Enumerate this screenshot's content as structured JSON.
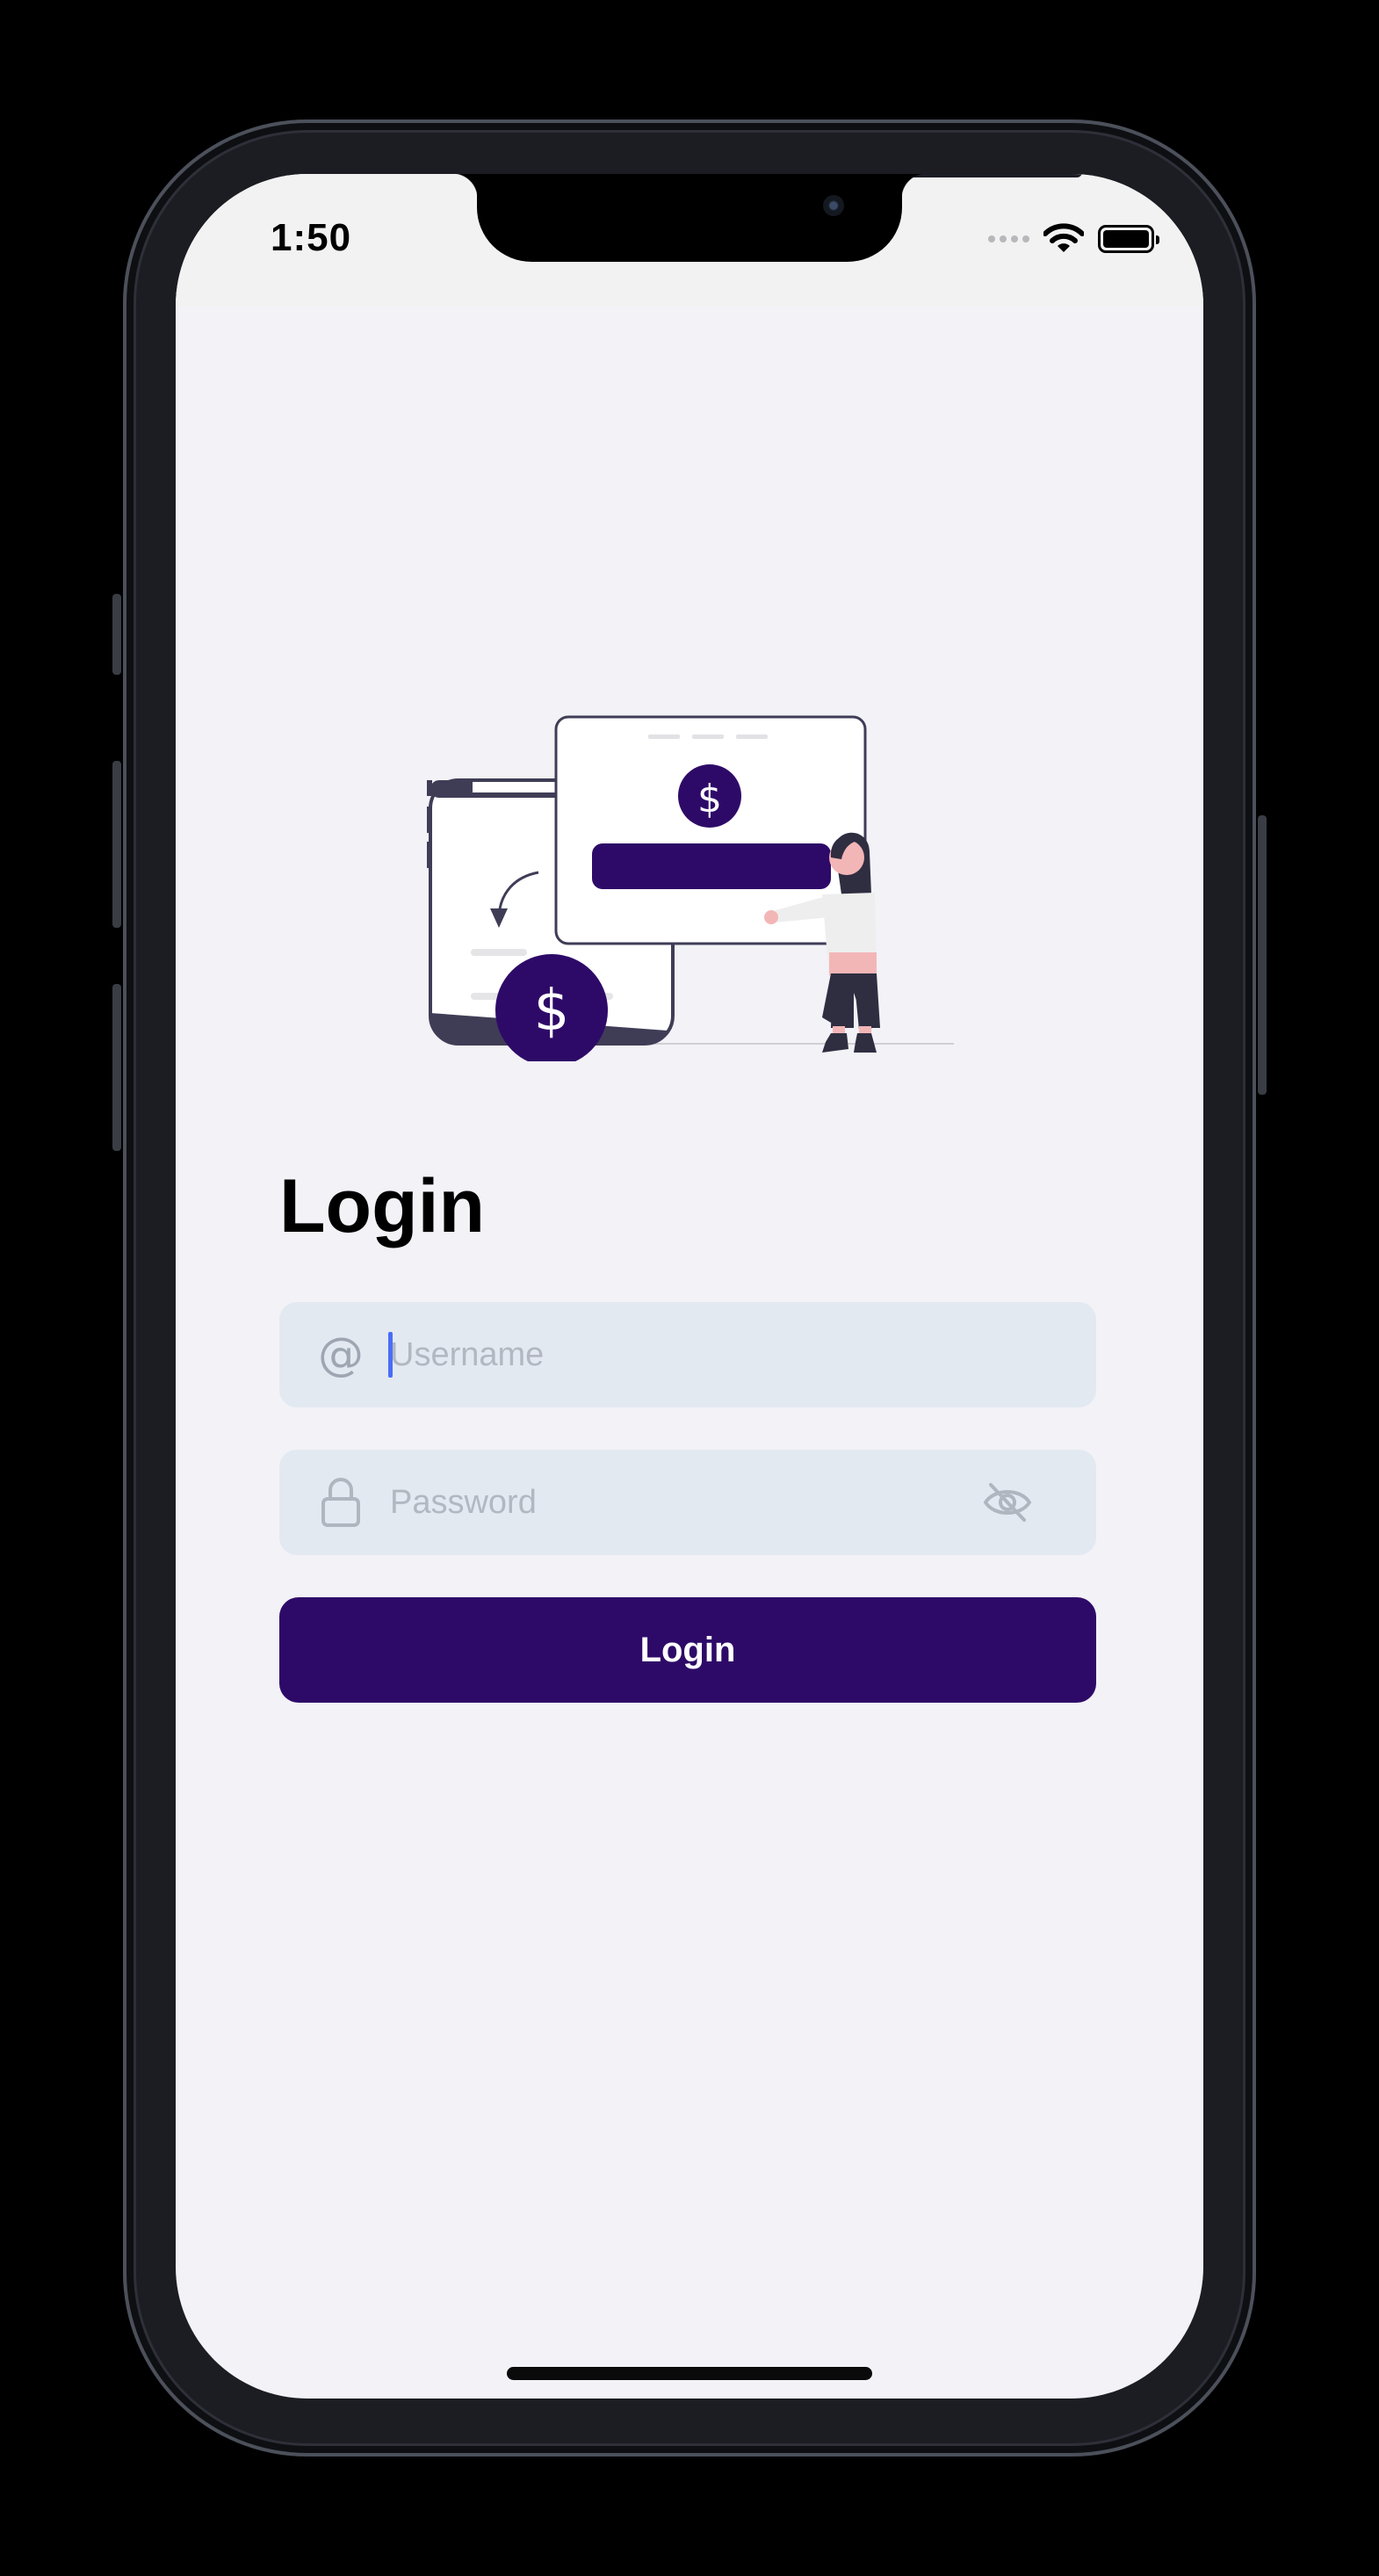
{
  "status_bar": {
    "time": "1:50"
  },
  "login": {
    "title": "Login",
    "username": {
      "value": "",
      "placeholder": "Username",
      "icon": "at-icon"
    },
    "password": {
      "value": "",
      "placeholder": "Password",
      "icon": "lock-icon",
      "toggle_icon": "eye-off-icon"
    },
    "submit_label": "Login"
  },
  "illustration": {
    "currency_symbol": "$"
  },
  "colors": {
    "primary": "#2e0a68",
    "background": "#f2f2f7",
    "field_background": "#e3e9f1",
    "placeholder": "#b2b7c1",
    "caret": "#4a6cf7"
  }
}
